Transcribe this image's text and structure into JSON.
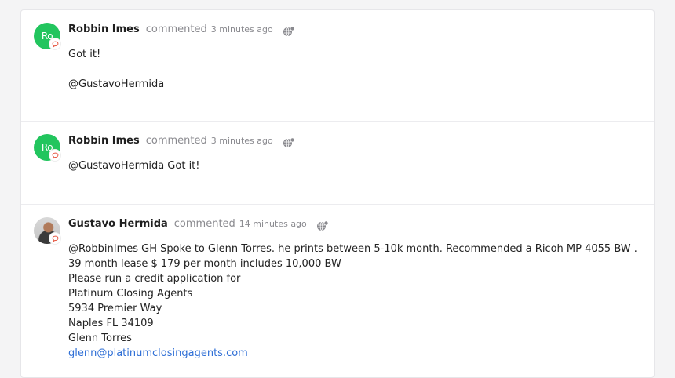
{
  "comments": [
    {
      "initials": "Ro",
      "author": "Robbin Imes",
      "action": "commented",
      "time": "3 minutes ago",
      "lines": [
        "Got it!",
        "",
        "@GustavoHermida"
      ]
    },
    {
      "initials": "Ro",
      "author": "Robbin Imes",
      "action": "commented",
      "time": "3 minutes ago",
      "lines": [
        "@GustavoHermida Got it!"
      ]
    },
    {
      "initials": "",
      "author": "Gustavo Hermida",
      "action": "commented",
      "time": "14 minutes ago",
      "lines": [
        "@RobbinImes GH Spoke to Glenn Torres. he prints between 5-10k month. Recommended a Ricoh MP 4055 BW .",
        "39 month lease $ 179 per month includes 10,000 BW",
        "Please run a credit application for",
        "Platinum Closing Agents",
        "5934 Premier Way",
        "Naples FL 34109",
        "Glenn Torres"
      ],
      "email": "glenn@platinumclosingagents.com"
    }
  ],
  "colors": {
    "avatar": "#22c55e",
    "bubble_icon": "#e5533d",
    "link": "#2f6fd6"
  },
  "icons": {
    "visibility": "globe-icon",
    "type": "comment-bubble-icon"
  }
}
